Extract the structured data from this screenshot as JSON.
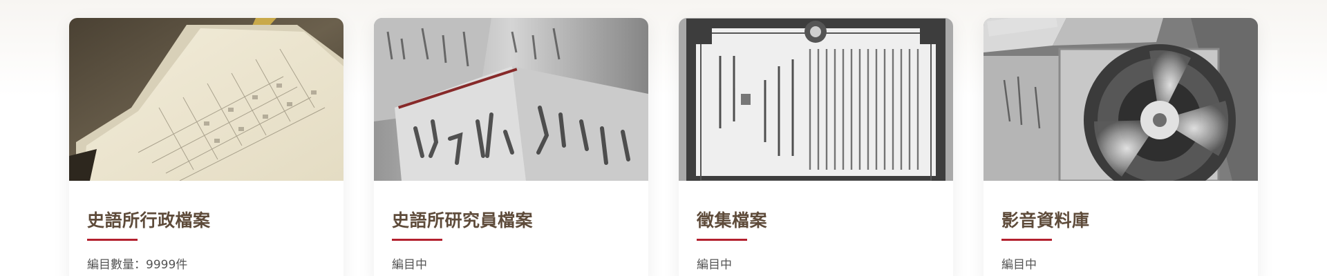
{
  "cards": [
    {
      "title": "史語所行政檔案",
      "meta": "編目數量：9999件",
      "image_icon": "ledger-photo"
    },
    {
      "title": "史語所研究員檔案",
      "meta": "編目中",
      "image_icon": "manuscript-photo"
    },
    {
      "title": "徵集檔案",
      "meta": "編目中",
      "image_icon": "certificate-photo"
    },
    {
      "title": "影音資料庫",
      "meta": "編目中",
      "image_icon": "tape-reel-photo"
    }
  ],
  "colors": {
    "title": "#5e4b3a",
    "accent": "#b3202e",
    "meta": "#555555"
  }
}
